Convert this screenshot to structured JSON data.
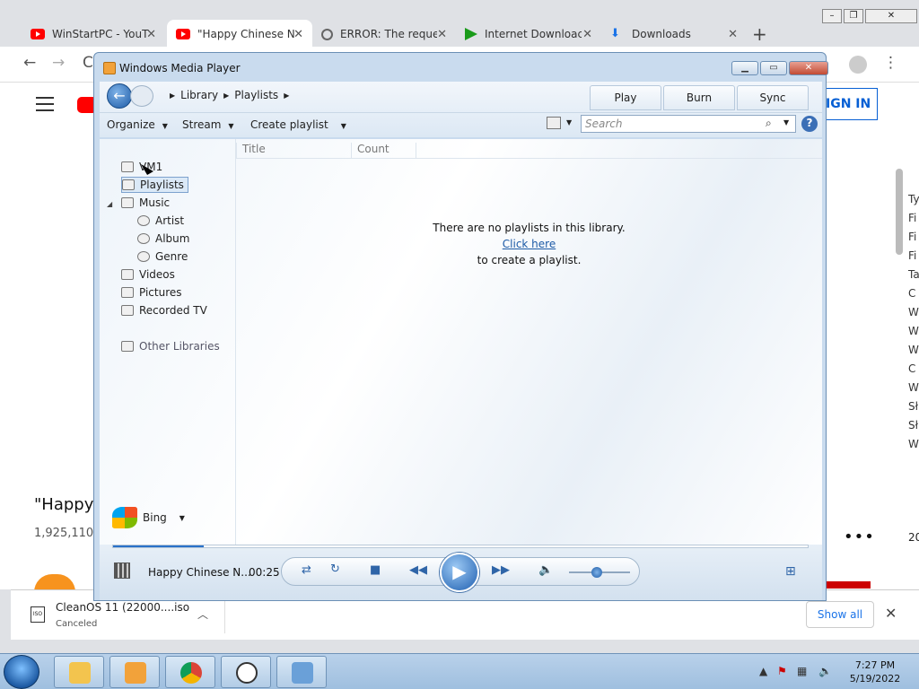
{
  "browser": {
    "tabs": [
      {
        "title": "WinStartPC - YouT",
        "close": "✕"
      },
      {
        "title": "\"Happy Chinese N",
        "close": "✕"
      },
      {
        "title": "ERROR: The reque",
        "close": "✕"
      },
      {
        "title": "Internet Downloac",
        "close": "✕"
      },
      {
        "title": "Downloads",
        "close": "✕"
      }
    ],
    "new_tab": "+",
    "page": {
      "signin": "IGN IN",
      "video_title": "\"Happy (",
      "views": "1,925,110",
      "more": "•••",
      "right_column": [
        "Ty",
        "Fi",
        "Fi",
        "Fi",
        "Ta",
        "C",
        "W",
        "W",
        "W",
        "C",
        "W",
        "Sł",
        "Sł",
        "W"
      ],
      "right_edge_text": "20"
    },
    "download": {
      "filename": "CleanOS 11 (22000....iso",
      "status": "Canceled",
      "show_all": "Show all"
    }
  },
  "wmp": {
    "title": "Windows Media Player",
    "breadcrumb": [
      "Library",
      "Playlists"
    ],
    "tabs": [
      "Play",
      "Burn",
      "Sync"
    ],
    "commands": [
      "Organize",
      "Stream",
      "Create playlist"
    ],
    "search_placeholder": "Search",
    "help": "?",
    "nav": {
      "vm": "VM1",
      "playlists": "Playlists",
      "music": "Music",
      "artist": "Artist",
      "album": "Album",
      "genre": "Genre",
      "videos": "Videos",
      "pictures": "Pictures",
      "recorded_tv": "Recorded TV",
      "other_libraries": "Other Libraries",
      "bing": "Bing"
    },
    "columns": [
      "Title",
      "Count"
    ],
    "empty": {
      "line1": "There are no playlists in this library.",
      "link": "Click here",
      "line3": "to create a playlist."
    },
    "now_playing": {
      "title": "Happy Chinese N...",
      "time": "00:25",
      "progress": 0.13,
      "volume": 0.45
    }
  },
  "taskbar": {
    "time": "7:27 PM",
    "date": "5/19/2022"
  }
}
